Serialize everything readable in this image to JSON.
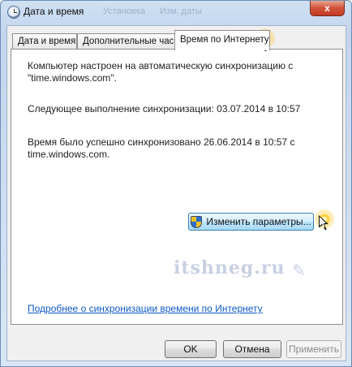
{
  "window": {
    "title": "Дата и время",
    "close_label": "x",
    "ghost_title_1": "Установка",
    "ghost_title_2": "Изм. даты"
  },
  "tabs": [
    {
      "label": "Дата и время"
    },
    {
      "label": "Дополнительные часы"
    },
    {
      "label": "Время по Интернету"
    }
  ],
  "panel": {
    "line1": "Компьютер настроен на автоматическую синхронизацию с",
    "line2": "\"time.windows.com\".",
    "next_sync": "Следующее выполнение синхронизации: 03.07.2014 в 10:57",
    "last_sync_1": "Время было успешно синхронизовано 26.06.2014 в 10:57 с",
    "last_sync_2": "time.windows.com.",
    "change_settings_label": "Изменить параметры...",
    "help_link": "Подробнее о синхронизации времени по Интернету",
    "watermark": "itshneg.ru"
  },
  "footer": {
    "ok_label": "OK",
    "cancel_label": "Отмена",
    "apply_label": "Применить"
  }
}
